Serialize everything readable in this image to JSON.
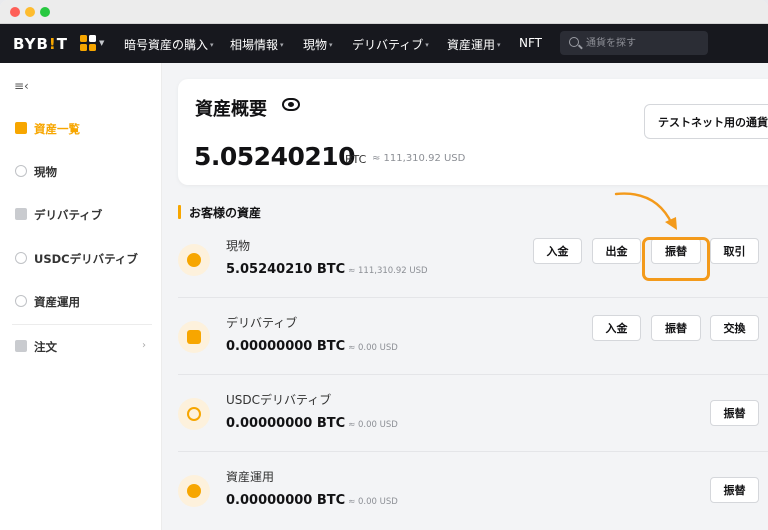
{
  "brand": {
    "logo_main": "BYB",
    "logo_bang": "!",
    "logo_end": "T",
    "accent": "#f7a600"
  },
  "nav": {
    "items": [
      {
        "label": "暗号資産の購入",
        "caret": "▾"
      },
      {
        "label": "相場情報",
        "caret": "▾"
      },
      {
        "label": "現物",
        "caret": "▾"
      },
      {
        "label": "デリバティブ",
        "caret": "▾"
      },
      {
        "label": "資産運用",
        "caret": "▾"
      },
      {
        "label": "NFT",
        "caret": ""
      }
    ],
    "search_placeholder": "通貨を探す"
  },
  "sidebar": {
    "collapse_icon": "≡‹",
    "items": [
      {
        "label": "資産一覧",
        "icon": "wallet-icon",
        "active": true
      },
      {
        "label": "現物",
        "icon": "coins-icon",
        "active": false
      },
      {
        "label": "デリバティブ",
        "icon": "derivatives-icon",
        "active": false
      },
      {
        "label": "USDCデリバティブ",
        "icon": "usdc-icon",
        "active": false
      },
      {
        "label": "資産運用",
        "icon": "piggy-bank-icon",
        "active": false
      },
      {
        "label": "注文",
        "icon": "orders-icon",
        "active": false,
        "chevron": "›"
      }
    ]
  },
  "overview": {
    "title": "資産概要",
    "amount": "5.05240210",
    "unit": "BTC",
    "fiat": "≈ 111,310.92 USD",
    "testnet_button": "テストネット用の通貨"
  },
  "section": {
    "title": "お客様の資産"
  },
  "assets": [
    {
      "name": "現物",
      "amount": "5.05240210 BTC",
      "fiat": "≈ 111,310.92 USD",
      "icon": "coins-icon",
      "buttons": [
        "入金",
        "出金",
        "振替",
        "取引"
      ]
    },
    {
      "name": "デリバティブ",
      "amount": "0.00000000 BTC",
      "fiat": "≈ 0.00 USD",
      "icon": "derivatives-icon",
      "buttons": [
        "入金",
        "振替",
        "交換"
      ]
    },
    {
      "name": "USDCデリバティブ",
      "amount": "0.00000000 BTC",
      "fiat": "≈ 0.00 USD",
      "icon": "usdc-icon",
      "buttons": [
        "振替"
      ]
    },
    {
      "name": "資産運用",
      "amount": "0.00000000 BTC",
      "fiat": "≈ 0.00 USD",
      "icon": "piggy-bank-icon",
      "buttons": [
        "振替"
      ]
    }
  ]
}
